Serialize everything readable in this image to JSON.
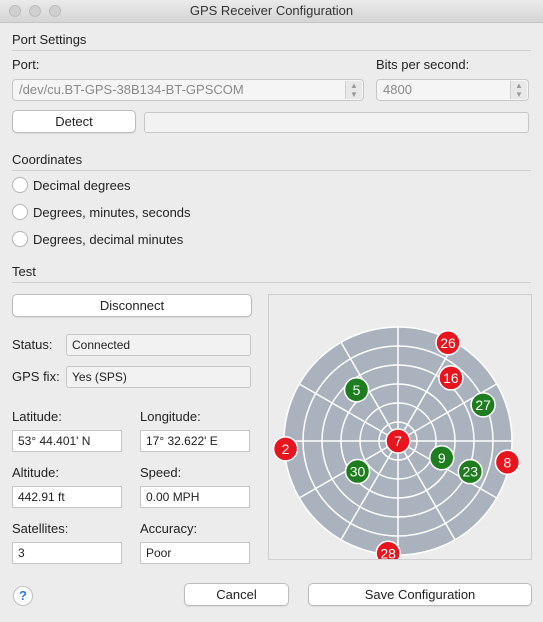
{
  "window": {
    "title": "GPS Receiver Configuration"
  },
  "port": {
    "section_title": "Port Settings",
    "port_label": "Port:",
    "port_value": "/dev/cu.BT-GPS-38B134-BT-GPSCOM",
    "bps_label": "Bits per second:",
    "bps_value": "4800",
    "detect_label": "Detect",
    "detect_status": ""
  },
  "coordinates": {
    "section_title": "Coordinates",
    "options": [
      {
        "label": "Decimal degrees"
      },
      {
        "label": "Degrees, minutes, seconds"
      },
      {
        "label": "Degrees, decimal minutes"
      }
    ]
  },
  "test": {
    "section_title": "Test",
    "disconnect_label": "Disconnect",
    "status_label": "Status:",
    "status_value": "Connected",
    "fix_label": "GPS fix:",
    "fix_value": "Yes (SPS)",
    "latitude_label": "Latitude:",
    "latitude_value": "53° 44.401' N",
    "longitude_label": "Longitude:",
    "longitude_value": "17° 32.622' E",
    "altitude_label": "Altitude:",
    "altitude_value": "442.91 ft",
    "speed_label": "Speed:",
    "speed_value": "0.00 MPH",
    "satellites_label": "Satellites:",
    "satellites_value": "3",
    "accuracy_label": "Accuracy:",
    "accuracy_value": "Poor"
  },
  "skyplot": {
    "colors": {
      "used": "#1e7d1e",
      "unused": "#e8141e",
      "disc": "#a9b2bd",
      "grid": "#ffffff"
    },
    "satellites": [
      {
        "id": "26",
        "azimuth": 27,
        "elevation": 3,
        "used": false
      },
      {
        "id": "16",
        "azimuth": 40,
        "elevation": 25,
        "used": false
      },
      {
        "id": "5",
        "azimuth": 321,
        "elevation": 38,
        "used": true
      },
      {
        "id": "27",
        "azimuth": 67,
        "elevation": 17,
        "used": true
      },
      {
        "id": "2",
        "azimuth": 266,
        "elevation": 1,
        "used": false
      },
      {
        "id": "7",
        "azimuth": 0,
        "elevation": 90,
        "used": false
      },
      {
        "id": "9",
        "azimuth": 111,
        "elevation": 53,
        "used": true
      },
      {
        "id": "30",
        "azimuth": 233,
        "elevation": 50,
        "used": true
      },
      {
        "id": "23",
        "azimuth": 113,
        "elevation": 28,
        "used": true
      },
      {
        "id": "8",
        "azimuth": 101,
        "elevation": 2,
        "used": false
      },
      {
        "id": "28",
        "azimuth": 185,
        "elevation": 1,
        "used": false
      }
    ]
  },
  "footer": {
    "help_label": "?",
    "cancel_label": "Cancel",
    "save_label": "Save Configuration"
  }
}
